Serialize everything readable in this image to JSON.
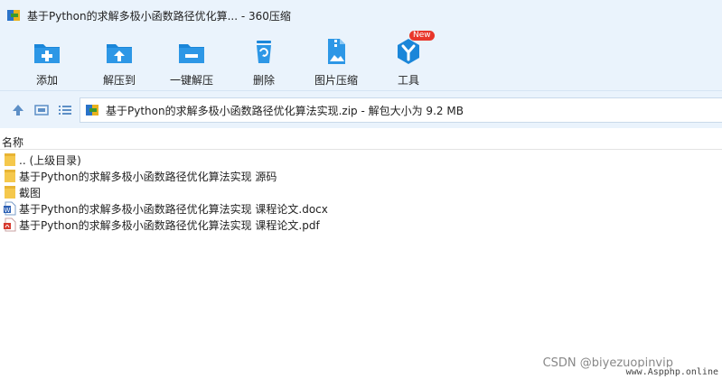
{
  "window": {
    "title": "基于Python的求解多极小函数路径优化算... - 360压缩"
  },
  "toolbar": {
    "items": [
      {
        "label": "添加",
        "icon": "add-folder-icon"
      },
      {
        "label": "解压到",
        "icon": "extract-to-icon"
      },
      {
        "label": "一键解压",
        "icon": "one-click-extract-icon"
      },
      {
        "label": "删除",
        "icon": "delete-icon"
      },
      {
        "label": "图片压缩",
        "icon": "image-compress-icon"
      },
      {
        "label": "工具",
        "icon": "tools-icon",
        "badge": "New"
      }
    ]
  },
  "address": {
    "text": "基于Python的求解多极小函数路径优化算法实现.zip - 解包大小为 9.2 MB"
  },
  "list": {
    "column_name": "名称",
    "files": [
      {
        "name": ".. (上级目录)",
        "type": "folder"
      },
      {
        "name": "基于Python的求解多极小函数路径优化算法实现 源码",
        "type": "folder"
      },
      {
        "name": "截图",
        "type": "folder"
      },
      {
        "name": "基于Python的求解多极小函数路径优化算法实现 课程论文.docx",
        "type": "docx"
      },
      {
        "name": "基于Python的求解多极小函数路径优化算法实现 课程论文.pdf",
        "type": "pdf"
      }
    ]
  },
  "watermark": {
    "csdn": "CSDN @biyezuopinvip",
    "site": "www.Aspphp.online"
  },
  "colors": {
    "toolbar_bg": "#eaf3fc",
    "icon_blue": "#1a86d9",
    "folder_yellow": "#f5c84c",
    "badge_red": "#e8362b"
  }
}
